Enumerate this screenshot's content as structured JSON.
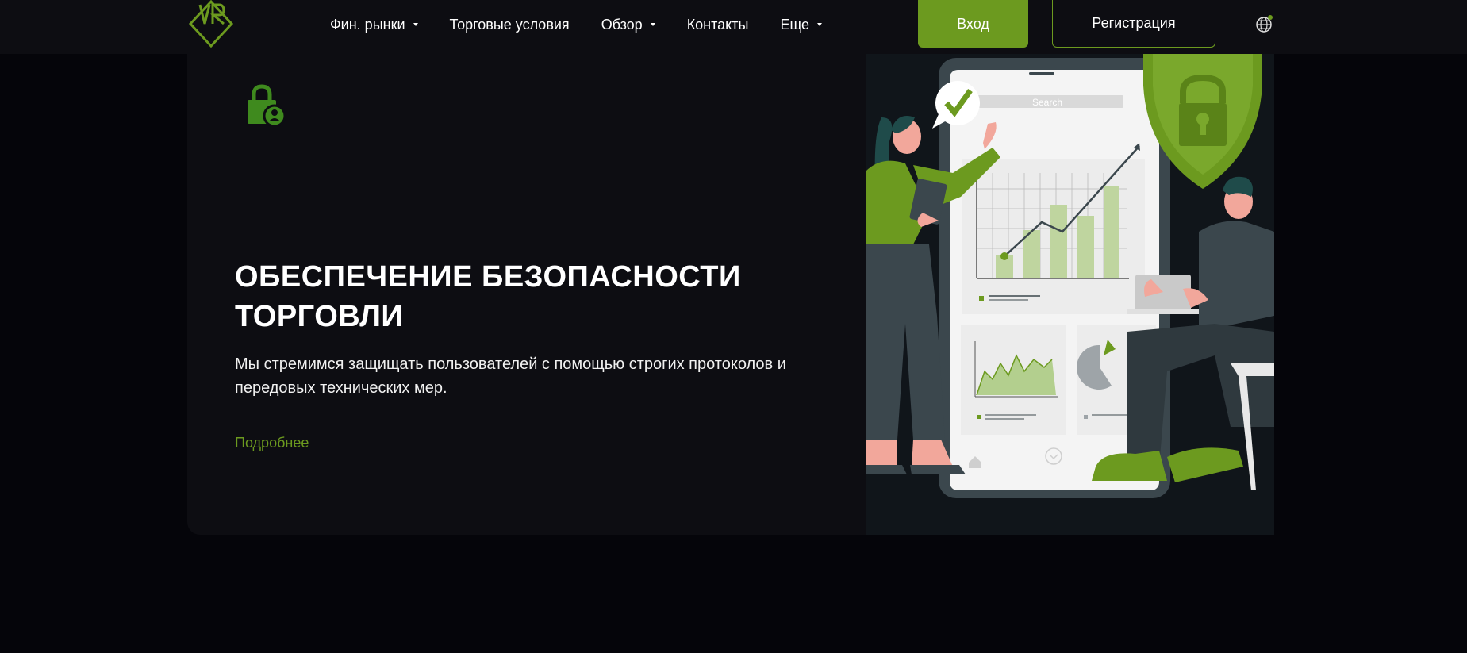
{
  "header": {
    "logo_text": "VR",
    "nav": [
      {
        "label": "Фин. рынки",
        "has_dropdown": true
      },
      {
        "label": "Торговые условия",
        "has_dropdown": false
      },
      {
        "label": "Обзор",
        "has_dropdown": true
      },
      {
        "label": "Контакты",
        "has_dropdown": false
      },
      {
        "label": "Еще",
        "has_dropdown": true
      }
    ],
    "login_label": "Вход",
    "register_label": "Регистрация",
    "language_icon": "globe-icon"
  },
  "hero": {
    "icon": "lock-user-icon",
    "title_line1": "ОБЕСПЕЧЕНИЕ БЕЗОПАСНОСТИ",
    "title_line2": "ТОРГОВЛИ",
    "description": "Мы стремимся защищать пользователей с помощью строгих протоколов и передовых технических мер.",
    "link_label": "Подробнее"
  },
  "illustration": {
    "search_placeholder": "Search",
    "icons": [
      "shield-lock-icon",
      "checkmark-icon",
      "home-icon",
      "chevron-down-icon"
    ]
  },
  "colors": {
    "accent": "#6c9a1f",
    "background": "#05050a",
    "panel": "#0d0d12"
  }
}
